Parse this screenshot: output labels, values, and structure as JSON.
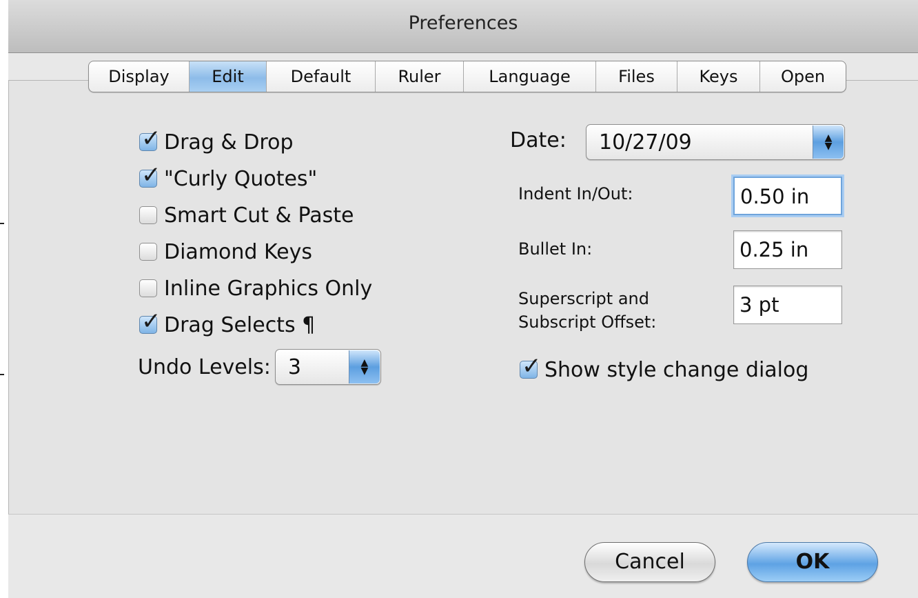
{
  "window": {
    "title": "Preferences"
  },
  "tabs": [
    {
      "label": "Display",
      "active": false
    },
    {
      "label": "Edit",
      "active": true
    },
    {
      "label": "Default",
      "active": false
    },
    {
      "label": "Ruler",
      "active": false
    },
    {
      "label": "Language",
      "active": false
    },
    {
      "label": "Files",
      "active": false
    },
    {
      "label": "Keys",
      "active": false
    },
    {
      "label": "Open",
      "active": false
    }
  ],
  "options": [
    {
      "label": "Drag & Drop",
      "checked": true
    },
    {
      "label": "\"Curly Quotes\"",
      "checked": true
    },
    {
      "label": "Smart Cut & Paste",
      "checked": false
    },
    {
      "label": "Diamond Keys",
      "checked": false
    },
    {
      "label": "Inline Graphics Only",
      "checked": false
    },
    {
      "label": "Drag Selects ¶",
      "checked": true
    }
  ],
  "undo": {
    "label": "Undo Levels:",
    "value": "3"
  },
  "date": {
    "label": "Date:",
    "value": "10/27/09"
  },
  "indent": {
    "label": "Indent In/Out:",
    "value": "0.50 in"
  },
  "bullet": {
    "label": "Bullet In:",
    "value": "0.25 in"
  },
  "offset": {
    "label_line1": "Superscript and",
    "label_line2": "Subscript Offset:",
    "value": "3 pt"
  },
  "style_dialog": {
    "label": "Show style change dialog",
    "checked": true
  },
  "buttons": {
    "cancel": "Cancel",
    "ok": "OK"
  },
  "colors": {
    "accent": "#5ea2e4",
    "background": "#e8e8e8"
  }
}
